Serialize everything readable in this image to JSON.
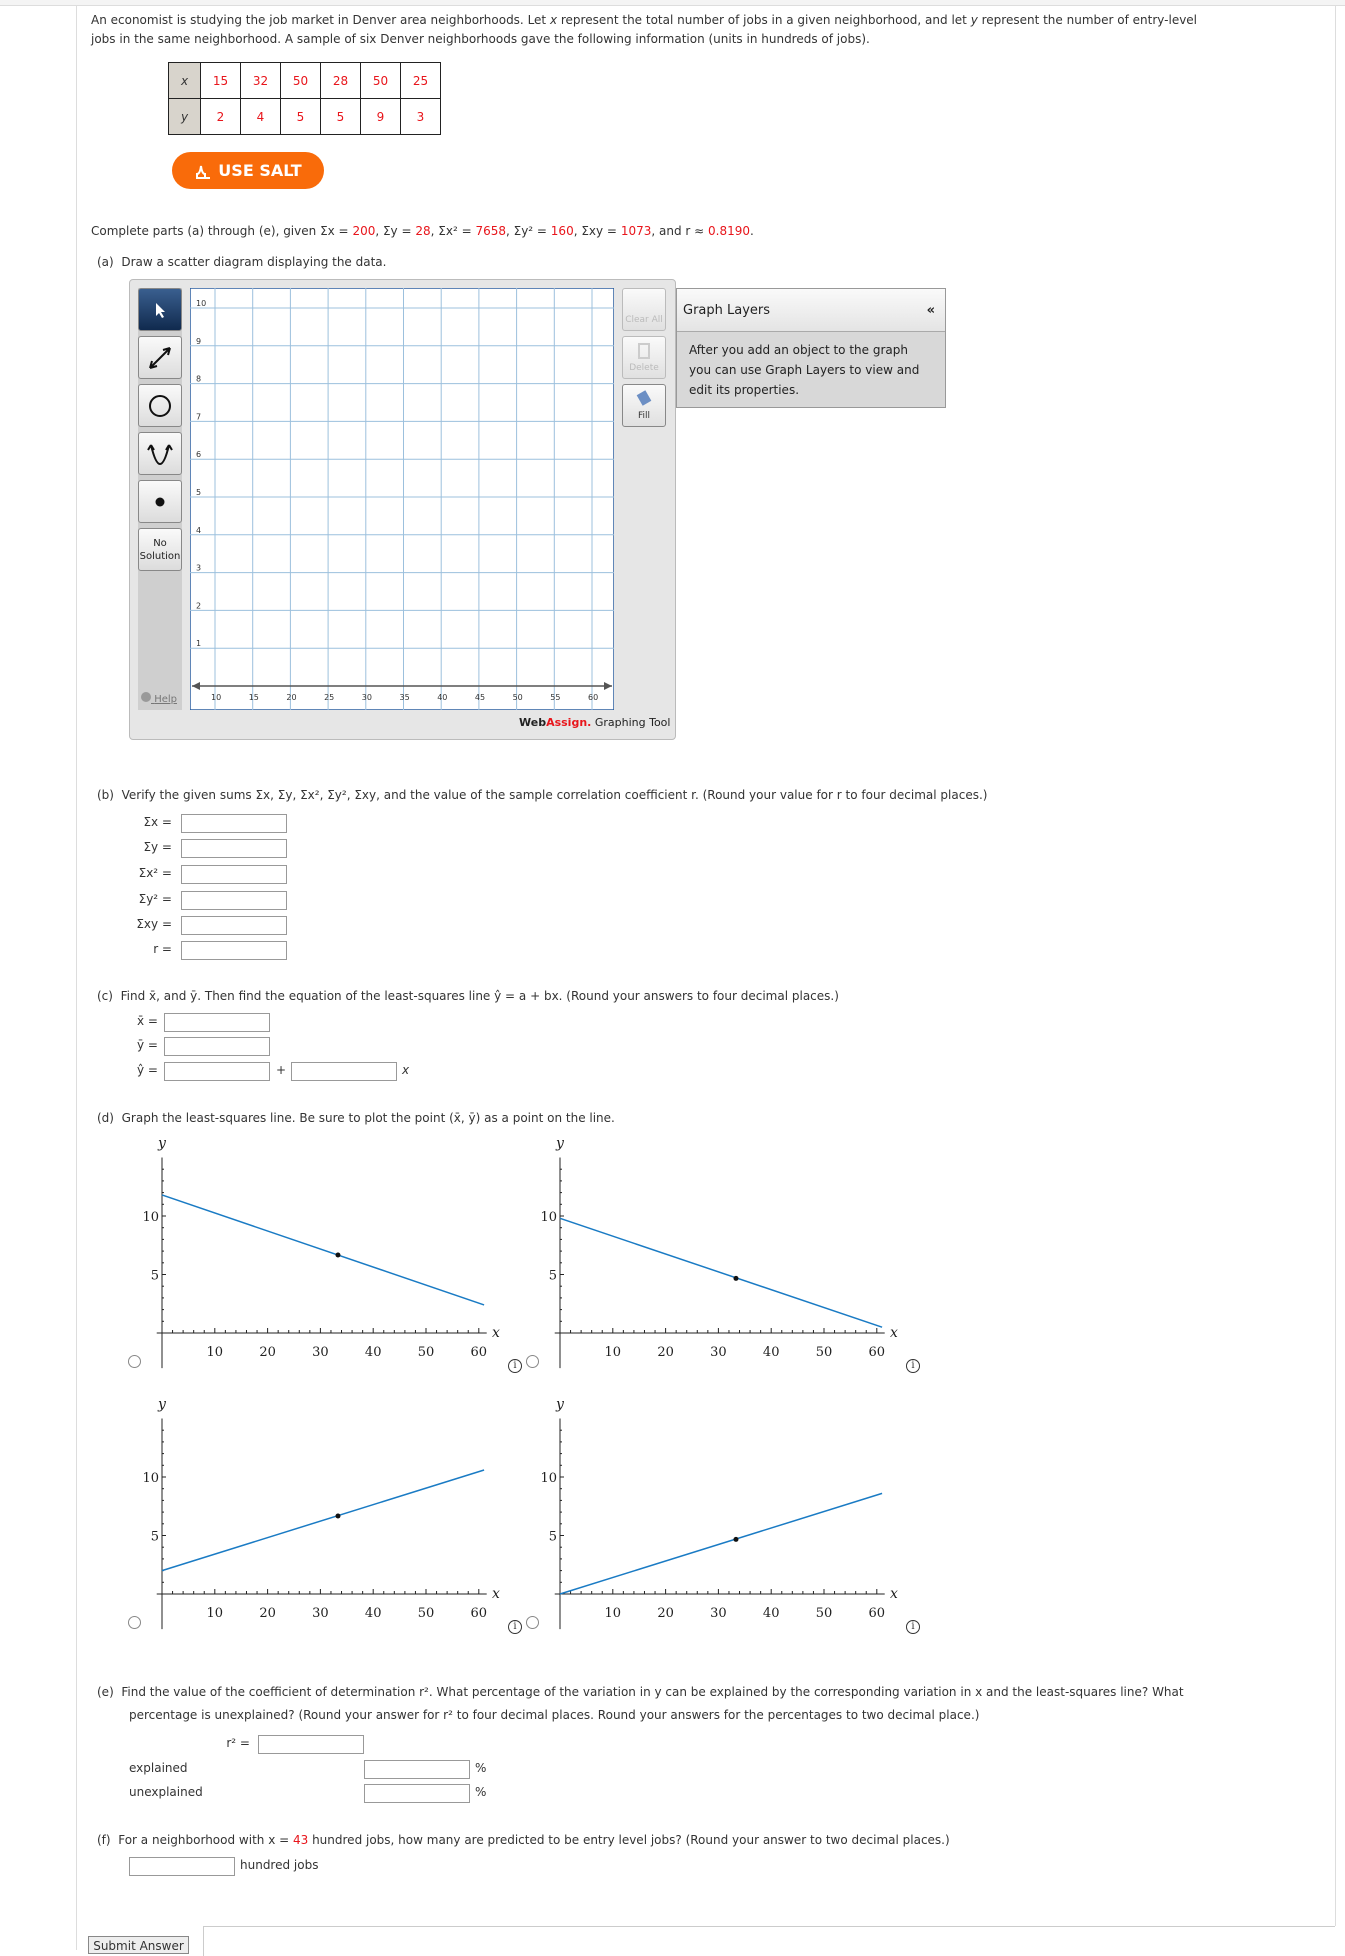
{
  "intro": {
    "line1_a": "An economist is studying the job market in Denver area neighborhoods. Let ",
    "line1_b": " represent the total number of jobs in a given neighborhood, and let ",
    "line1_c": " represent the number of entry-level",
    "line2": "jobs in the same neighborhood. A sample of six Denver neighborhoods gave the following information (units in hundreds of jobs).",
    "x": "x",
    "y": "y"
  },
  "table": {
    "x_label": "x",
    "y_label": "y",
    "x": [
      "15",
      "32",
      "50",
      "28",
      "50",
      "25"
    ],
    "y": [
      "2",
      "4",
      "5",
      "5",
      "9",
      "3"
    ]
  },
  "salt_button": "USE SALT",
  "given": {
    "prefix": "Complete parts (a) through (e), given ",
    "sx": "Σx = ",
    "sx_v": "200",
    "sy": ", Σy = ",
    "sy_v": "28",
    "sx2": ", Σx² = ",
    "sx2_v": "7658",
    "sy2": ", Σy² = ",
    "sy2_v": "160",
    "sxy": ", Σxy = ",
    "sxy_v": "1073",
    "r": ", and r ≈ ",
    "r_v": "0.8190",
    "end": "."
  },
  "part_a": {
    "label": "(a)",
    "text": "Draw a scatter diagram displaying the data."
  },
  "graph_tool": {
    "tools": [
      "select",
      "line",
      "circle",
      "parabola",
      "point"
    ],
    "no_solution": [
      "No",
      "Solution"
    ],
    "help": "Help",
    "clear_all": "Clear All",
    "delete": "Delete",
    "fill": "Fill",
    "brand_web": "Web",
    "brand_assign": "Assign.",
    "brand_suffix": " Graphing Tool",
    "x_ticks": [
      10,
      15,
      20,
      25,
      30,
      35,
      40,
      45,
      50,
      55,
      60
    ],
    "y_ticks": [
      1,
      2,
      3,
      4,
      5,
      6,
      7,
      8,
      9,
      10
    ],
    "layers_title": "Graph Layers",
    "layers_collapse": "«",
    "layers_body": "After you add an object to the graph you can use Graph Layers to view and edit its properties."
  },
  "part_b": {
    "label": "(b)",
    "text": "Verify the given sums Σx, Σy, Σx², Σy², Σxy, and the value of the sample correlation coefficient r. (Round your value for r to four decimal places.)",
    "fields": [
      "Σx =",
      "Σy =",
      "Σx² =",
      "Σy² =",
      "Σxy =",
      "r ="
    ]
  },
  "part_c": {
    "label": "(c)",
    "text": "Find x̄, and ȳ. Then find the equation of the least-squares line ŷ = a + bx. (Round your answers to four decimal places.)",
    "fields": [
      "x̄ =",
      "ȳ =",
      "ŷ ="
    ],
    "plus": "+",
    "x": "x"
  },
  "part_d": {
    "label": "(d)",
    "text": "Graph the least-squares line. Be sure to plot the point (x̄, ȳ) as a point on the line.",
    "info": "i"
  },
  "chart_data": [
    {
      "type": "line",
      "xlabel": "x",
      "ylabel": "y",
      "x_ticks": [
        10,
        20,
        30,
        40,
        50,
        60
      ],
      "y_ticks": [
        5,
        10
      ],
      "xlim": [
        0,
        61
      ],
      "ylim": [
        -2,
        15
      ],
      "line": {
        "x": [
          0,
          61
        ],
        "y": [
          11.8,
          2.4
        ]
      },
      "point": {
        "x": 33.33,
        "y": 6.67
      },
      "color": "#1a7bc4"
    },
    {
      "type": "line",
      "xlabel": "x",
      "ylabel": "y",
      "x_ticks": [
        10,
        20,
        30,
        40,
        50,
        60
      ],
      "y_ticks": [
        5,
        10
      ],
      "xlim": [
        0,
        61
      ],
      "ylim": [
        -2,
        15
      ],
      "line": {
        "x": [
          0,
          61
        ],
        "y": [
          9.8,
          0.5
        ]
      },
      "point": {
        "x": 33.33,
        "y": 4.67
      },
      "color": "#1a7bc4"
    },
    {
      "type": "line",
      "xlabel": "x",
      "ylabel": "y",
      "x_ticks": [
        10,
        20,
        30,
        40,
        50,
        60
      ],
      "y_ticks": [
        5,
        10
      ],
      "xlim": [
        0,
        61
      ],
      "ylim": [
        -2,
        15
      ],
      "line": {
        "x": [
          0,
          61
        ],
        "y": [
          2.0,
          10.6
        ]
      },
      "point": {
        "x": 33.33,
        "y": 6.67
      },
      "color": "#1a7bc4"
    },
    {
      "type": "line",
      "xlabel": "x",
      "ylabel": "y",
      "x_ticks": [
        10,
        20,
        30,
        40,
        50,
        60
      ],
      "y_ticks": [
        5,
        10
      ],
      "xlim": [
        0,
        61
      ],
      "ylim": [
        -2,
        15
      ],
      "line": {
        "x": [
          0,
          61
        ],
        "y": [
          0,
          8.6
        ]
      },
      "point": {
        "x": 33.33,
        "y": 4.67
      },
      "color": "#1a7bc4"
    }
  ],
  "part_e": {
    "label": "(e)",
    "line1": "Find the value of the coefficient of determination r². What percentage of the variation in y can be explained by the corresponding variation in x and the least-squares line? What",
    "line2": "percentage is unexplained? (Round your answer for r² to four decimal places. Round your answers for the percentages to two decimal place.)",
    "r2": "r² =",
    "explained": "explained",
    "unexplained": "unexplained",
    "pct": "%"
  },
  "part_f": {
    "label": "(f)",
    "a": "For a neighborhood with x = ",
    "x_v": "43",
    "b": " hundred jobs, how many are predicted to be entry level jobs? (Round your answer to two decimal places.)",
    "unit": "hundred jobs"
  },
  "submit": "Submit Answer"
}
